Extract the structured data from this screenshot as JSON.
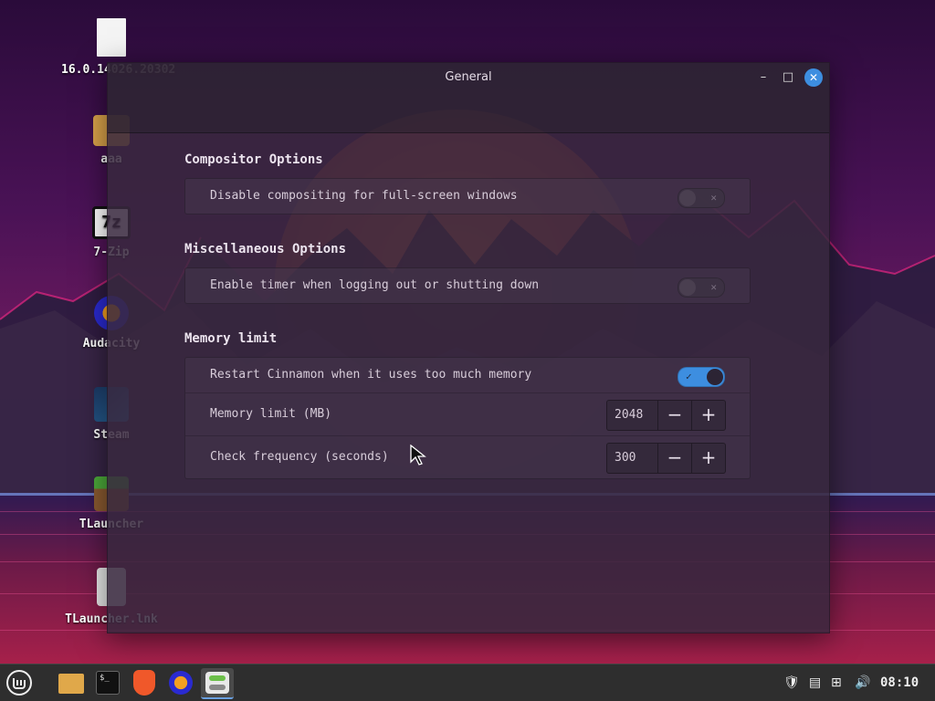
{
  "desktop": {
    "icons": [
      {
        "name": "16.0.14026.20302"
      },
      {
        "name": "aaa"
      },
      {
        "name": "7-Zip"
      },
      {
        "name": "Audacity"
      },
      {
        "name": "Steam"
      },
      {
        "name": "TLauncher"
      },
      {
        "name": "TLauncher.lnk"
      }
    ]
  },
  "window": {
    "title": "General",
    "sections": [
      {
        "title": "Compositor Options",
        "rows": [
          {
            "label": "Disable compositing for full-screen windows",
            "type": "switch",
            "checked": false
          }
        ]
      },
      {
        "title": "Miscellaneous Options",
        "rows": [
          {
            "label": "Enable timer when logging out or shutting down",
            "type": "switch",
            "checked": false
          }
        ]
      },
      {
        "title": "Memory limit",
        "rows": [
          {
            "label": "Restart Cinnamon when it uses too much memory",
            "type": "switch",
            "checked": true
          },
          {
            "label": "Memory limit (MB)",
            "type": "spin",
            "value": "2048"
          },
          {
            "label": "Check frequency (seconds)",
            "type": "spin",
            "value": "300"
          }
        ]
      }
    ],
    "controls": {
      "minimize": "–",
      "maximize": "□",
      "close": "✕"
    },
    "spin_minus": "−",
    "spin_plus": "+"
  },
  "taskbar": {
    "apps": [
      "menu-icon",
      "files-icon",
      "terminal-icon",
      "brave-icon",
      "audacity-icon",
      "settings-icon"
    ],
    "clock": "08:10"
  },
  "colors": {
    "accent": "#3d8ee0"
  }
}
